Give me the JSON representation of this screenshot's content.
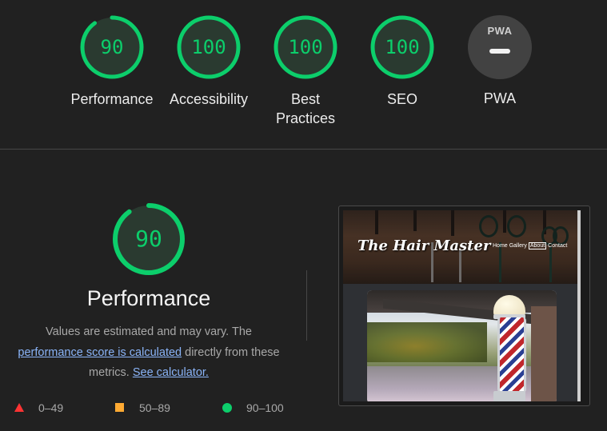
{
  "gauges": [
    {
      "score": "90",
      "label": "Performance",
      "value": 90
    },
    {
      "score": "100",
      "label": "Accessibility",
      "value": 100
    },
    {
      "score": "100",
      "label": "Best Practices",
      "value": 100
    },
    {
      "score": "100",
      "label": "SEO",
      "value": 100
    },
    {
      "score": "",
      "label": "PWA",
      "badge": "PWA"
    }
  ],
  "colors": {
    "pass": "#0cce6b",
    "average": "#ffaa33",
    "fail": "#ff3333",
    "background": "#212121"
  },
  "performance": {
    "score": "90",
    "value": 90,
    "title": "Performance",
    "desc_text_1": "Values are estimated and may vary. The",
    "desc_link_1": "performance score is calculated",
    "desc_text_2": "directly from these",
    "desc_text_3": "metrics.",
    "desc_link_2": "See calculator."
  },
  "legend": [
    {
      "icon": "red-triangle-icon",
      "range": "0–49"
    },
    {
      "icon": "orange-square-icon",
      "range": "50–89"
    },
    {
      "icon": "green-circle-icon",
      "range": "90–100"
    }
  ],
  "preview": {
    "site_title": "The Hair Master",
    "nav": [
      "Home",
      "Gallery",
      "About",
      "Contact"
    ],
    "active_nav": "About"
  }
}
